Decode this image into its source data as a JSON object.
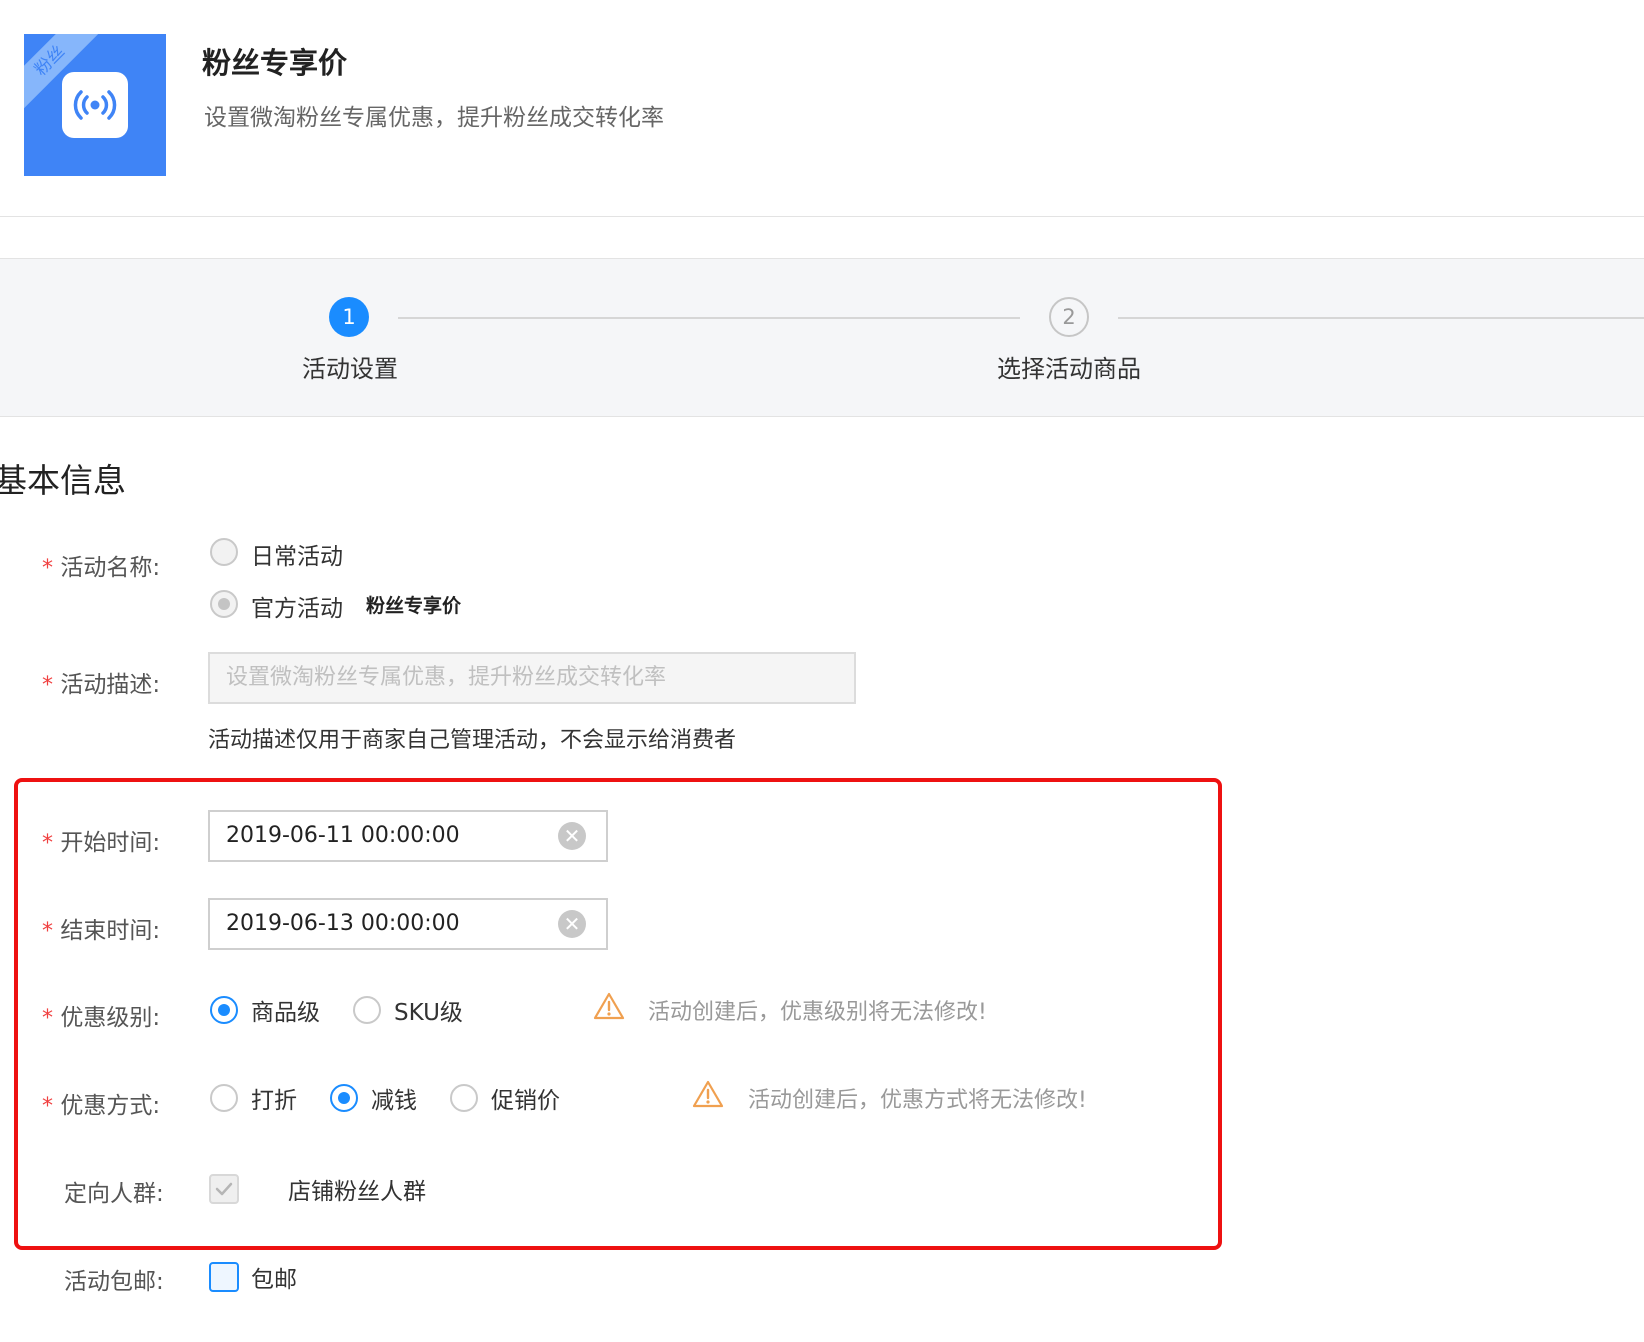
{
  "header": {
    "ribbon_text": "粉丝",
    "title": "粉丝专享价",
    "subtitle": "设置微淘粉丝专属优惠，提升粉丝成交转化率"
  },
  "steps": [
    {
      "number": "1",
      "label": "活动设置",
      "active": true
    },
    {
      "number": "2",
      "label": "选择活动商品",
      "active": false
    }
  ],
  "section_title": "基本信息",
  "form": {
    "required_mark": "*",
    "activity_name": {
      "label": "活动名称:",
      "options": [
        {
          "label": "日常活动",
          "checked": false
        },
        {
          "label": "官方活动",
          "checked": true,
          "suffix": "粉丝专享价"
        }
      ]
    },
    "activity_desc": {
      "label": "活动描述:",
      "placeholder": "设置微淘粉丝专属优惠，提升粉丝成交转化率",
      "hint": "活动描述仅用于商家自己管理活动，不会显示给消费者"
    },
    "start_time": {
      "label": "开始时间:",
      "value": "2019-06-11 00:00:00"
    },
    "end_time": {
      "label": "结束时间:",
      "value": "2019-06-13 00:00:00"
    },
    "discount_level": {
      "label": "优惠级别:",
      "options": [
        {
          "label": "商品级",
          "checked": true
        },
        {
          "label": "SKU级",
          "checked": false
        }
      ],
      "warning": "活动创建后，优惠级别将无法修改!"
    },
    "discount_method": {
      "label": "优惠方式:",
      "options": [
        {
          "label": "打折",
          "checked": false
        },
        {
          "label": "减钱",
          "checked": true
        },
        {
          "label": "促销价",
          "checked": false
        }
      ],
      "warning": "活动创建后，优惠方式将无法修改!"
    },
    "target_group": {
      "label": "定向人群:",
      "option": "店铺粉丝人群",
      "checked": true
    },
    "free_shipping": {
      "label": "活动包邮:",
      "option": "包邮",
      "checked": false
    }
  },
  "colors": {
    "accent": "#1a8cff",
    "icon_bg": "#3f84f6",
    "highlight_box": "#ee1111",
    "warning": "#f0a050",
    "required": "#f04040"
  }
}
